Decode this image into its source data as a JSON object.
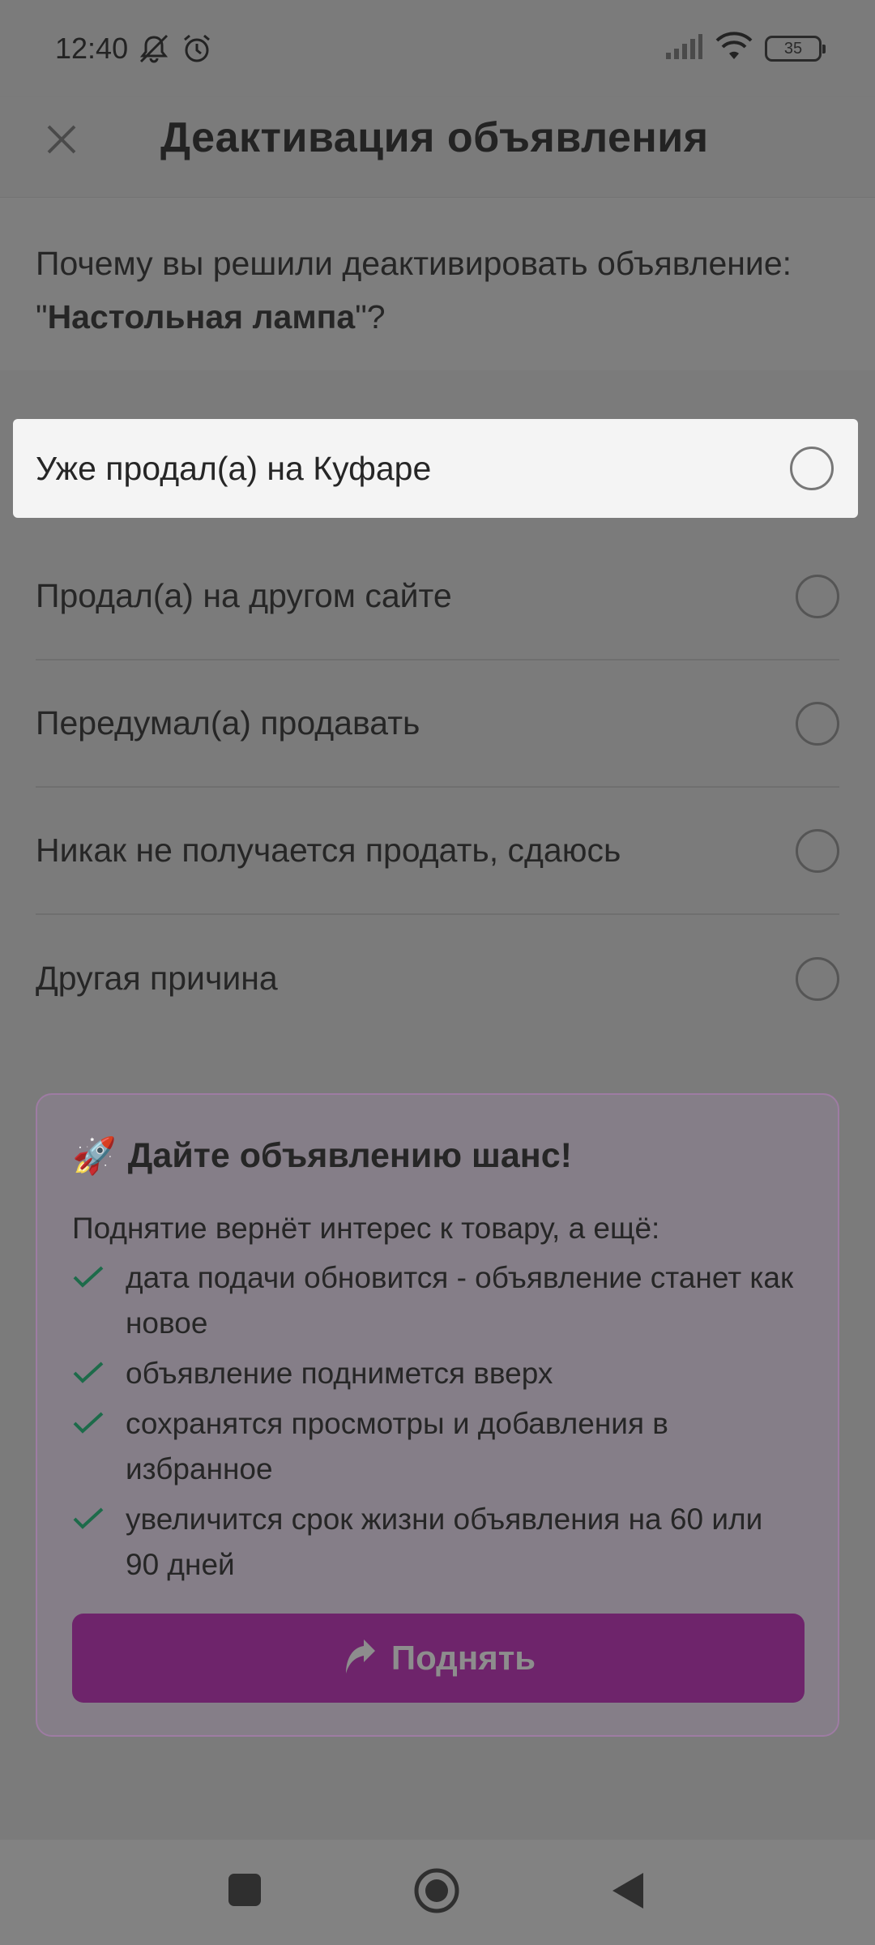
{
  "status_bar": {
    "time": "12:40",
    "icons": [
      "notifications-off-icon",
      "alarm-icon",
      "signal-icon",
      "wifi-icon"
    ],
    "battery": "35"
  },
  "app_bar": {
    "title": "Деактивация объявления",
    "close_icon": "close-icon"
  },
  "question": {
    "prefix": "Почему вы решили деактивировать объявление: \"",
    "item_name": "Настольная лампа",
    "suffix": "\"?"
  },
  "options": [
    {
      "label": "Уже продал(а) на Куфаре",
      "highlighted": true
    },
    {
      "label": "Продал(а) на другом сайте"
    },
    {
      "label": "Передумал(а) продавать"
    },
    {
      "label": "Никак не получается продать, сдаюсь"
    },
    {
      "label": "Другая причина"
    }
  ],
  "promo": {
    "emoji": "🚀",
    "title": "Дайте объявлению шанс!",
    "subtitle": "Поднятие вернёт интерес к товару, а ещё:",
    "benefits": [
      "дата подачи обновится - объявление станет как новое",
      "объявление поднимется вверх",
      "сохранятся просмотры и добавления в избранное",
      "увеличится срок жизни объявления на 60 или 90 дней"
    ],
    "button_label": "Поднять",
    "button_icon": "arrow-up-icon"
  },
  "nav_bar": {
    "icons": [
      "recents-icon",
      "home-icon",
      "back-icon"
    ]
  },
  "colors": {
    "scrim": "#7b7b7b",
    "highlight": "#f4f4f4",
    "promo_button": "#6e246b",
    "check": "#1d6b4a"
  }
}
